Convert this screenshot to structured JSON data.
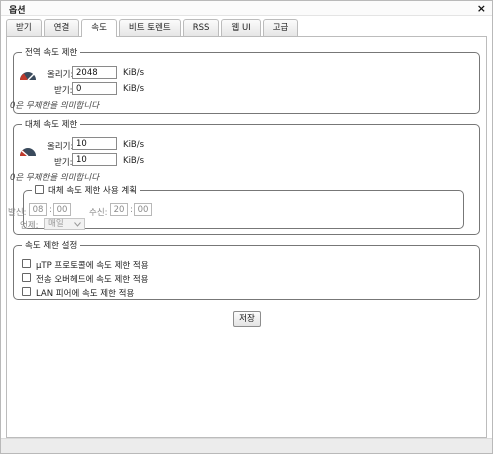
{
  "window": {
    "title": "옵션",
    "close_glyph": "×"
  },
  "tabs": [
    {
      "label": "받기"
    },
    {
      "label": "연결"
    },
    {
      "label": "속도",
      "active": true
    },
    {
      "label": "비트 토렌트"
    },
    {
      "label": "RSS"
    },
    {
      "label": "웹 UI"
    },
    {
      "label": "고급"
    }
  ],
  "global_limits": {
    "legend": "전역 속도 제한",
    "upload_label": "올리기:",
    "upload_value": "2048",
    "upload_unit": "KiB/s",
    "download_label": "받기:",
    "download_value": "0",
    "download_unit": "KiB/s",
    "note": "0은 무제한을 의미합니다",
    "icon": "speedometer-fast-icon"
  },
  "alt_limits": {
    "legend": "대체 속도 제한",
    "upload_label": "올리기:",
    "upload_value": "10",
    "upload_unit": "KiB/s",
    "download_label": "받기:",
    "download_value": "10",
    "download_unit": "KiB/s",
    "note": "0은 무제한을 의미합니다",
    "icon": "speedometer-slow-icon",
    "schedule": {
      "checkbox_label": "대체 속도 제한 사용 계획",
      "checked": false,
      "from_label": "발신:",
      "from_hour": "08",
      "from_min": "00",
      "to_label": "수신:",
      "to_hour": "20",
      "to_min": "00",
      "time_sep": ":",
      "when_label": "언제:",
      "when_value": "매일"
    }
  },
  "rate_settings": {
    "legend": "속도 제한 설정",
    "options": [
      {
        "label": "µTP 프로토콜에 속도 제한 적용",
        "checked": false
      },
      {
        "label": "전송 오버헤드에 속도 제한 적용",
        "checked": false
      },
      {
        "label": "LAN 피어에 속도 제한 적용",
        "checked": false
      }
    ]
  },
  "save_label": "저장",
  "colors": {
    "gauge_red": "#c0392b",
    "gauge_dark": "#3a4a5c",
    "border": "#777777"
  }
}
